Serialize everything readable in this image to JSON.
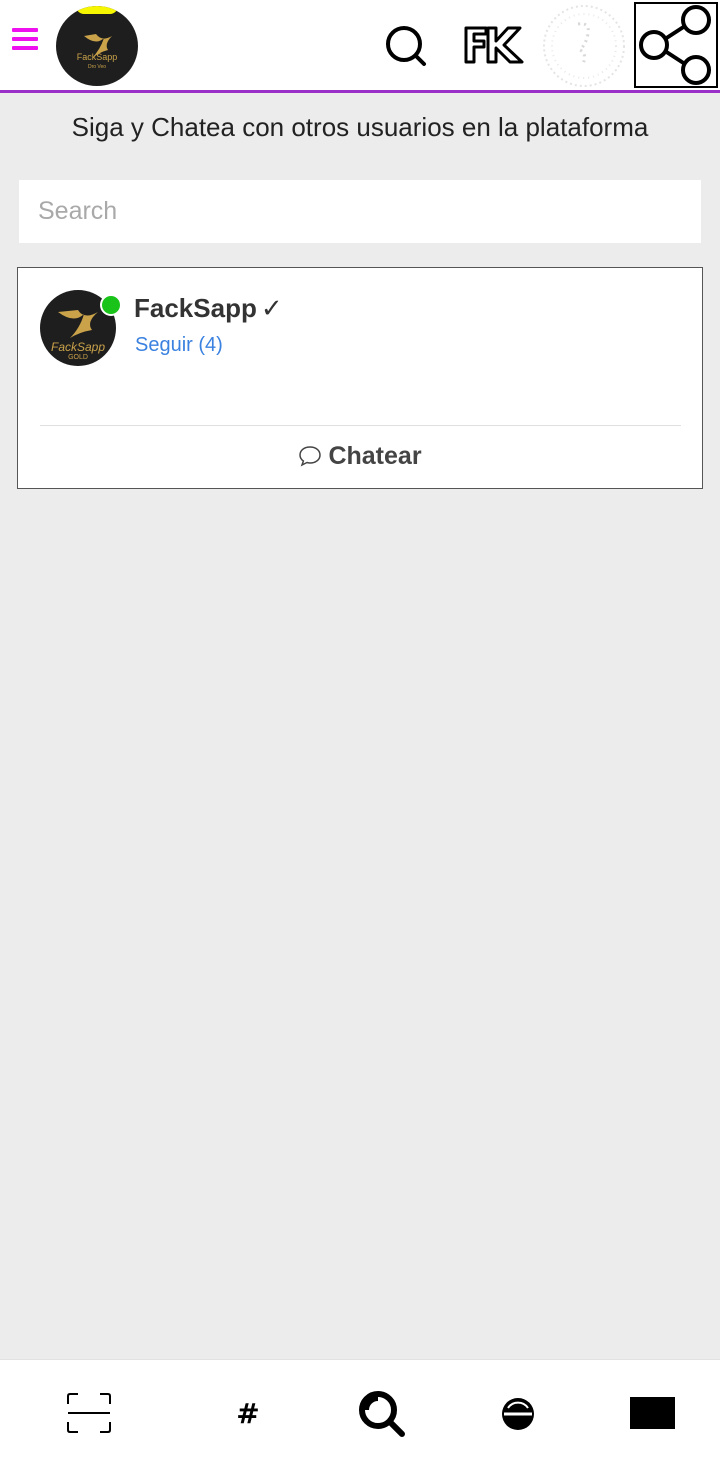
{
  "header": {
    "logo_text": "FackSapp",
    "logo_subtext": "Dro Veo"
  },
  "subtitle": "Siga y Chatea con otros usuarios en la plataforma",
  "search": {
    "placeholder": "Search",
    "value": ""
  },
  "user_card": {
    "avatar_text": "FackSapp",
    "avatar_subtext": "GOLD",
    "name": "FackSapp",
    "verified_mark": "✓",
    "follow_label": "Seguir (4)",
    "online": true,
    "chat_label": "Chatear"
  },
  "colors": {
    "menu_accent": "#ee10ee",
    "header_border": "#9b30c8",
    "online_dot": "#19c319",
    "link": "#3b82e0",
    "background": "#ececec"
  },
  "icons": {
    "menu": "hamburger-icon",
    "search": "search-icon",
    "brand": "fk-logo-icon",
    "profile": "dotted-avatar-icon",
    "share": "share-icon",
    "chat": "chat-bubble-icon",
    "nav": [
      "scan-icon",
      "hashtag-icon",
      "search-icon",
      "circle-icon",
      "rectangle-icon"
    ]
  }
}
